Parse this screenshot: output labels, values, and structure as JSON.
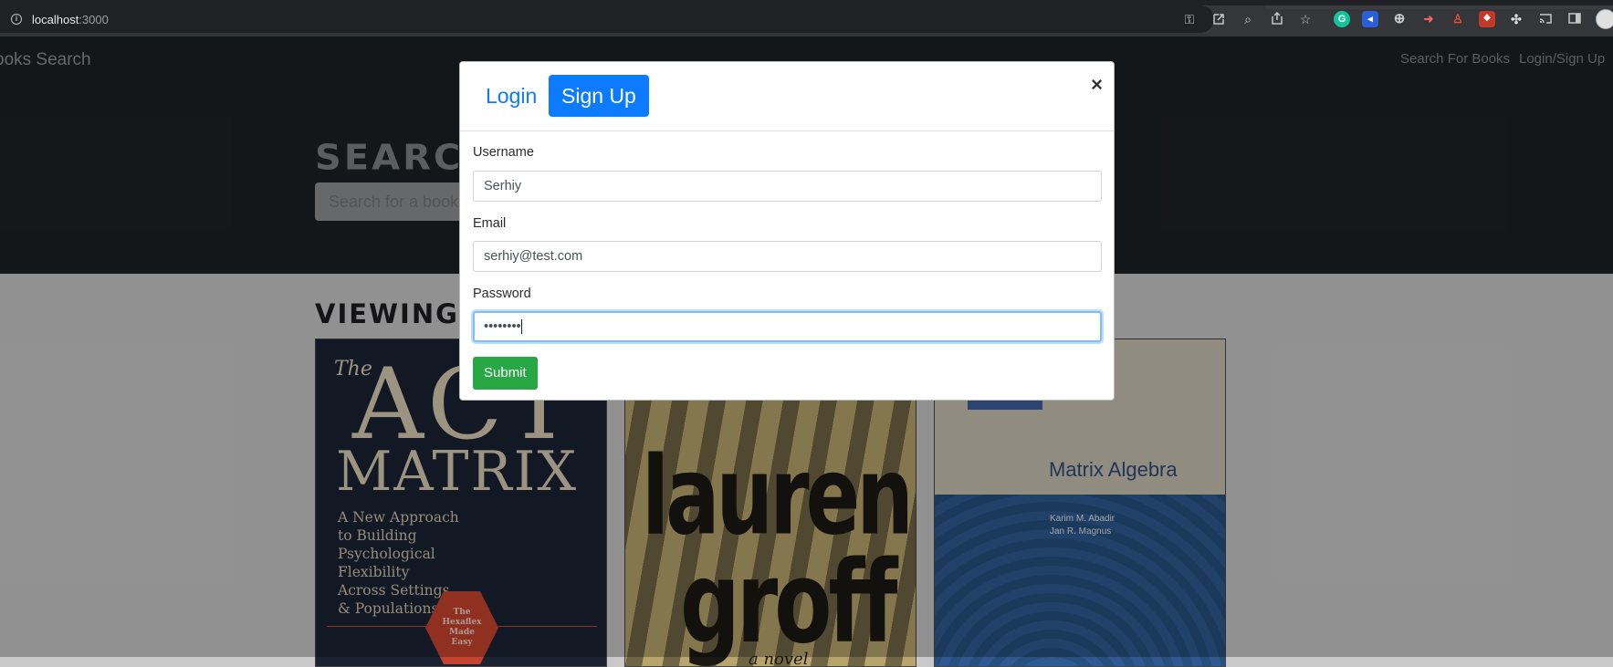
{
  "browser": {
    "url_host": "localhost",
    "url_port": ":3000"
  },
  "navbar": {
    "brand": "ooks Search",
    "links": [
      "Search For Books",
      "Login/Sign Up"
    ]
  },
  "hero": {
    "title": "SEARCH",
    "search_placeholder": "Search for a book"
  },
  "results": {
    "title": "VIEWING",
    "books": [
      {
        "cover_lines": [
          "The",
          "ACT",
          "MATRIX",
          "A New Approach",
          "to Building",
          "Psychological",
          "Flexibility",
          "Across Settings",
          "& Populations",
          "The",
          "Hexaflex",
          "Made",
          "Easy"
        ]
      },
      {
        "cover_lines": [
          "lauren",
          "groff",
          "a novel"
        ]
      },
      {
        "cover_lines": [
          "Matrix Algebra",
          "Karim M. Abadir",
          "Jan R. Magnus"
        ]
      }
    ]
  },
  "modal": {
    "tabs": [
      {
        "label": "Login",
        "active": false
      },
      {
        "label": "Sign Up",
        "active": true
      }
    ],
    "close_label": "×",
    "form": {
      "username_label": "Username",
      "username_value": "Serhiy",
      "email_label": "Email",
      "email_value": "serhiy@test.com",
      "password_label": "Password",
      "password_value": "••••••••",
      "submit_label": "Submit"
    }
  },
  "colors": {
    "primary": "#0d7bff",
    "success": "#28a745",
    "navbar_bg": "#1d2024"
  }
}
